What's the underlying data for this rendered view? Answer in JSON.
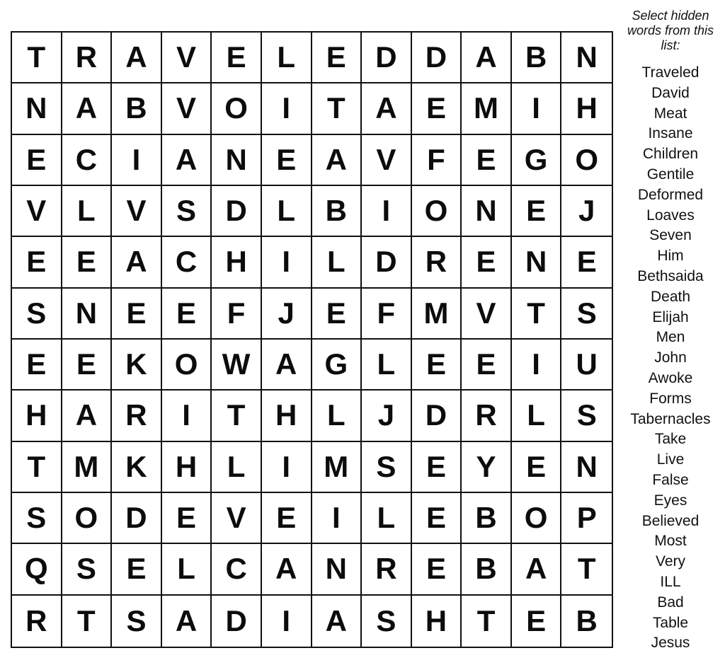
{
  "puzzle": {
    "grid": [
      [
        "T",
        "R",
        "A",
        "V",
        "E",
        "L",
        "E",
        "D",
        "D",
        "A",
        "B",
        "N"
      ],
      [
        "N",
        "A",
        "B",
        "V",
        "O",
        "I",
        "T",
        "A",
        "E",
        "M",
        "I",
        "H"
      ],
      [
        "E",
        "C",
        "I",
        "A",
        "N",
        "E",
        "A",
        "V",
        "F",
        "E",
        "G",
        "O"
      ],
      [
        "V",
        "L",
        "V",
        "S",
        "D",
        "L",
        "B",
        "I",
        "O",
        "N",
        "E",
        "J"
      ],
      [
        "E",
        "E",
        "A",
        "C",
        "H",
        "I",
        "L",
        "D",
        "R",
        "E",
        "N",
        "E"
      ],
      [
        "S",
        "N",
        "E",
        "E",
        "F",
        "J",
        "E",
        "F",
        "M",
        "V",
        "T",
        "S"
      ],
      [
        "E",
        "E",
        "K",
        "O",
        "W",
        "A",
        "G",
        "L",
        "E",
        "E",
        "I",
        "U"
      ],
      [
        "H",
        "A",
        "R",
        "I",
        "T",
        "H",
        "L",
        "J",
        "D",
        "R",
        "L",
        "S"
      ],
      [
        "T",
        "M",
        "K",
        "H",
        "L",
        "I",
        "M",
        "S",
        "E",
        "Y",
        "E",
        "N"
      ],
      [
        "S",
        "O",
        "D",
        "E",
        "V",
        "E",
        "I",
        "L",
        "E",
        "B",
        "O",
        "P"
      ],
      [
        "Q",
        "S",
        "E",
        "L",
        "C",
        "A",
        "N",
        "R",
        "E",
        "B",
        "A",
        "T"
      ],
      [
        "R",
        "T",
        "S",
        "A",
        "D",
        "I",
        "A",
        "S",
        "H",
        "T",
        "E",
        "B"
      ]
    ]
  },
  "sidebar": {
    "instructions": "Select hidden words from this list:",
    "words": [
      "Traveled",
      "David",
      "Meat",
      "Insane",
      "Children",
      "Gentile",
      "Deformed",
      "Loaves",
      "Seven",
      "Him",
      "Bethsaida",
      "Death",
      "Elijah",
      "Men",
      "John",
      "Awoke",
      "Forms",
      "Tabernacles",
      "Take",
      "Live",
      "False",
      "Eyes",
      "Believed",
      "Most",
      "Very",
      "ILL",
      "Bad",
      "Table",
      "Jesus"
    ]
  }
}
